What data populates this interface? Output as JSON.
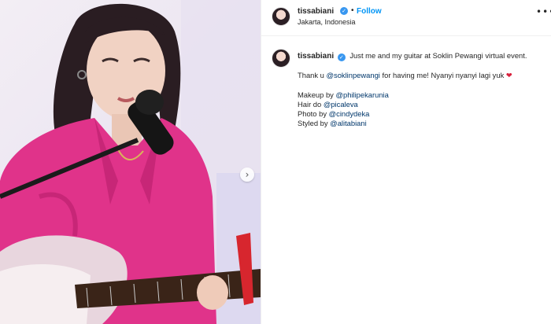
{
  "post": {
    "username": "tissabiani",
    "location": "Jakarta, Indonesia",
    "follow_label": "Follow",
    "separator": "•",
    "more_icon": "•••",
    "verified_glyph": "✓",
    "next_arrow_glyph": "›"
  },
  "caption": {
    "username": "tissabiani",
    "line1": "Just me and my guitar at Soklin Pewangi virtual event.",
    "line2_prefix": "Thank u ",
    "line2_mention": "@soklinpewangi",
    "line2_suffix": " for having me! Nyanyi nyanyi lagi yuk ",
    "heart_emoji": "❤",
    "credits": [
      {
        "label": "Makeup by ",
        "mention": "@philipekarunia"
      },
      {
        "label": "Hair do ",
        "mention": "@picaleva"
      },
      {
        "label": "Photo by ",
        "mention": "@cindydeka"
      },
      {
        "label": "Styled by ",
        "mention": "@alitabiani"
      }
    ]
  },
  "colors": {
    "link_blue": "#0095f6",
    "mention_blue": "#00376b",
    "verified_blue": "#3897f0",
    "shirt_pink": "#e0338a"
  }
}
